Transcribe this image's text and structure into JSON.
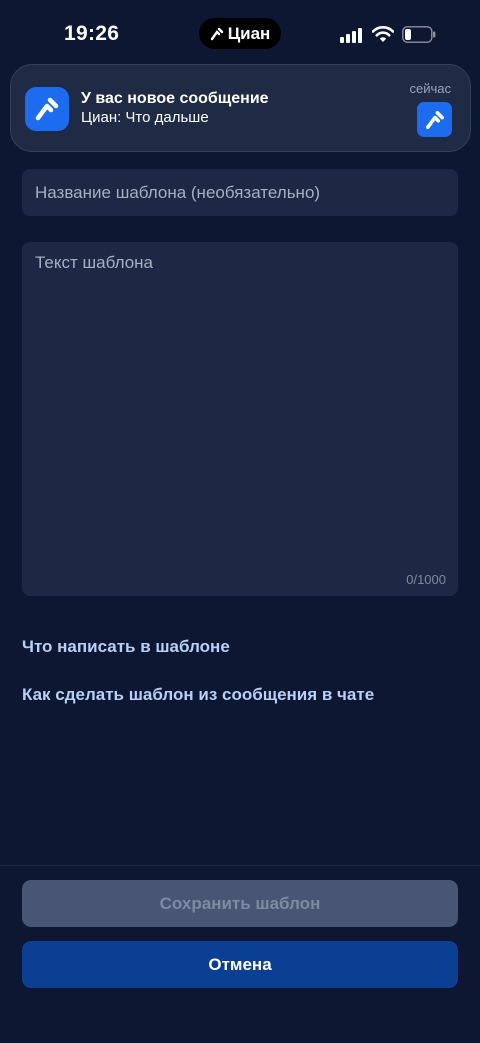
{
  "status_bar": {
    "time": "19:26",
    "island_label": "Циан",
    "icons": [
      "signal-icon",
      "wifi-icon",
      "battery-icon"
    ]
  },
  "notification": {
    "title": "У вас новое сообщение",
    "body": "Циан: Что дальше",
    "time": "сейчас",
    "app_icon": "cian-logo-icon",
    "accent_color": "#1d6cf0"
  },
  "form": {
    "name_placeholder": "Название шаблона (необязательно)",
    "name_value": "",
    "text_placeholder": "Текст шаблона",
    "text_value": "",
    "char_counter": "0/1000"
  },
  "links": {
    "what_to_write": "Что написать в шаблоне",
    "from_message": "Как сделать шаблон из сообщения в чате"
  },
  "actions": {
    "save_label": "Сохранить шаблон",
    "cancel_label": "Отмена"
  },
  "colors": {
    "background": "#0e1732",
    "field": "#1d2844",
    "link": "#b8d0f8",
    "primary_button": "#0a3f94",
    "disabled_button": "#485573"
  }
}
